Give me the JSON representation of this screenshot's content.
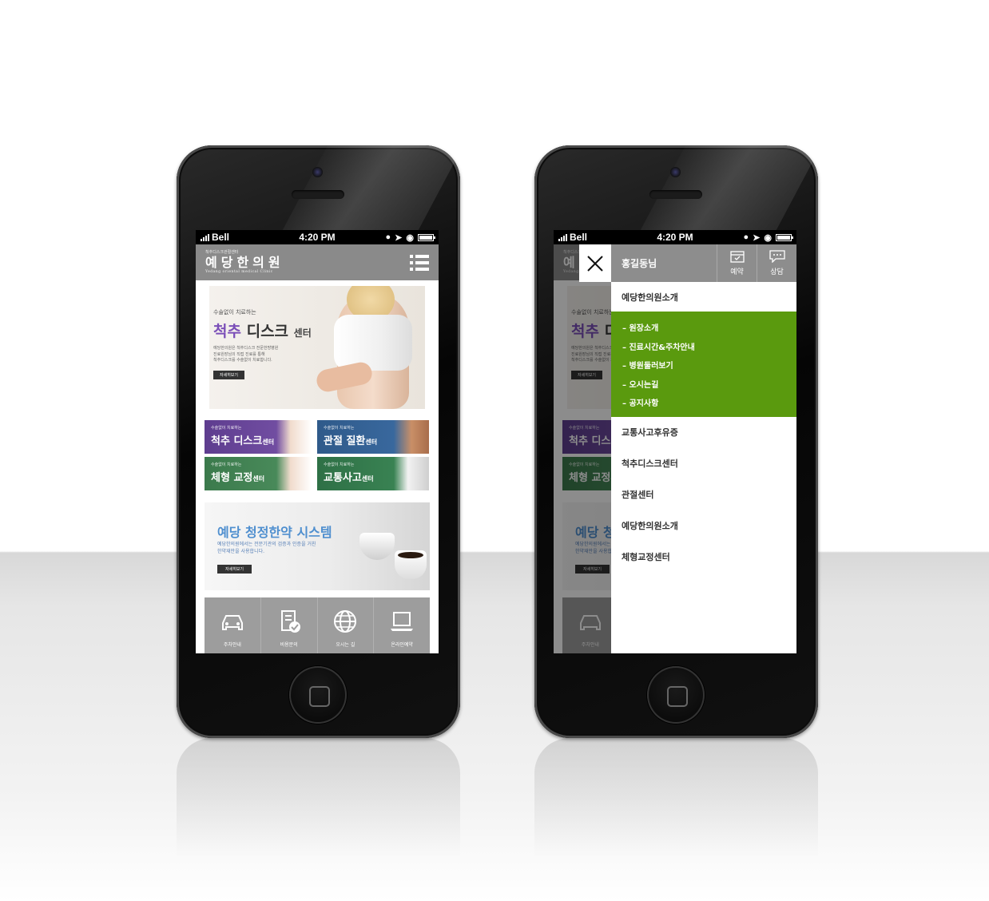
{
  "status": {
    "carrier": "Bell",
    "time": "4:20 PM"
  },
  "header": {
    "tagline": "척추디스크관절센터",
    "name": "예당한의원",
    "name_en": "Yedang oriental medical Clinic"
  },
  "hero": {
    "sub": "수술없이 치료하는",
    "title_hl": "척추",
    "title": " 디스크",
    "title_sm": "센터",
    "desc1": "예당한의원은 척추디스크 전문한방병원",
    "desc2": "진료원장님의 직접 진료를 통해",
    "desc3": "척추디스크를 수술없이 치료합니다.",
    "more": "자세히보기"
  },
  "tiles": [
    {
      "kicker": "수술없이 치료하는",
      "title": "척추 디스크",
      "suffix": "센터"
    },
    {
      "kicker": "수술없이 치료하는",
      "title": "관절 질환",
      "suffix": "센터"
    },
    {
      "kicker": "수술없이 치료하는",
      "title": "체형 교정",
      "suffix": "센터"
    },
    {
      "kicker": "수술없이 치료하는",
      "title": "교통사고",
      "suffix": "센터"
    }
  ],
  "banner": {
    "title": "예당 청정한약 시스템",
    "desc1": "예당한의원에서는 전문기관의 검증과 인증을 거친",
    "desc2": "한약재만을 사용합니다.",
    "more": "자세히보기"
  },
  "quick": [
    {
      "label": "주차안내",
      "icon": "car-icon"
    },
    {
      "label": "비용문의",
      "icon": "notebook-check-icon"
    },
    {
      "label": "오시는 길",
      "icon": "globe-icon"
    },
    {
      "label": "온라인예약",
      "icon": "laptop-icon"
    }
  ],
  "drawer": {
    "user": "홍길동님",
    "reserve": "예약",
    "consult": "상담",
    "first": "예당한의원소개",
    "subs": [
      "– 원장소개",
      "– 진료시간&주차안내",
      "– 병원둘러보기",
      "– 오시는길",
      "– 공지사항"
    ],
    "items": [
      "교통사고후유증",
      "척추디스크센터",
      "관절센터",
      "예당한의원소개",
      "체형교정센터"
    ]
  },
  "colors": {
    "accent_green": "#5a9a0e",
    "header_gray": "#8a8a8a",
    "purple": "#7b4fb8",
    "blue": "#4f8fcf"
  }
}
